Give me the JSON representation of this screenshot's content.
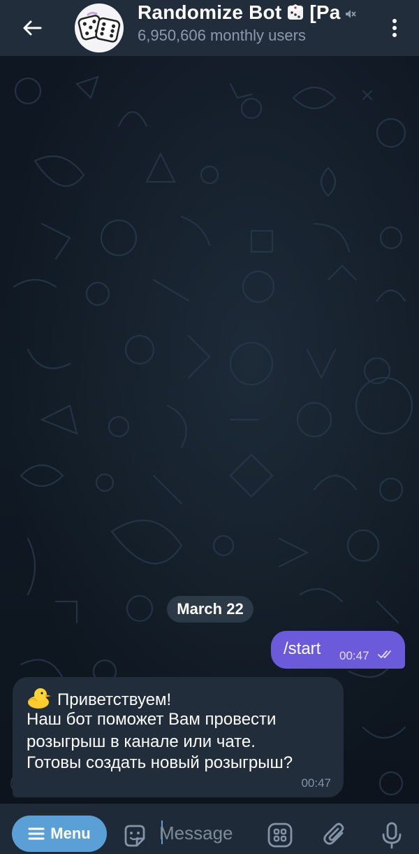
{
  "header": {
    "title": "Randomize Bot",
    "title_suffix": "[Pa",
    "subtitle": "6,950,606 monthly users"
  },
  "chat": {
    "date_chip": "March 22",
    "outgoing": {
      "text": "/start",
      "time": "00:47",
      "status": "read"
    },
    "incoming": {
      "emoji": "duck",
      "lines": [
        "Приветствуем!",
        "Наш бот поможет Вам провести",
        "розыгрыш в канале или чате.",
        "Готовы создать новый розыгрыш?"
      ],
      "time": "00:47"
    }
  },
  "input_bar": {
    "menu_label": "Menu",
    "placeholder": "Message"
  },
  "colors": {
    "header_bg": "#212d3b",
    "outgoing_bubble": "#6b5bdb",
    "incoming_bubble": "#212d3b",
    "menu_button": "#5aa0d7",
    "subtitle": "#8c9aab"
  },
  "icons": [
    "back-arrow-icon",
    "bot-avatar-dice",
    "dice-emoji-icon",
    "mute-icon",
    "more-vertical-icon",
    "double-check-icon",
    "duck-emoji-icon",
    "hamburger-icon",
    "sticker-icon",
    "bot-commands-icon",
    "attach-icon",
    "microphone-icon"
  ]
}
